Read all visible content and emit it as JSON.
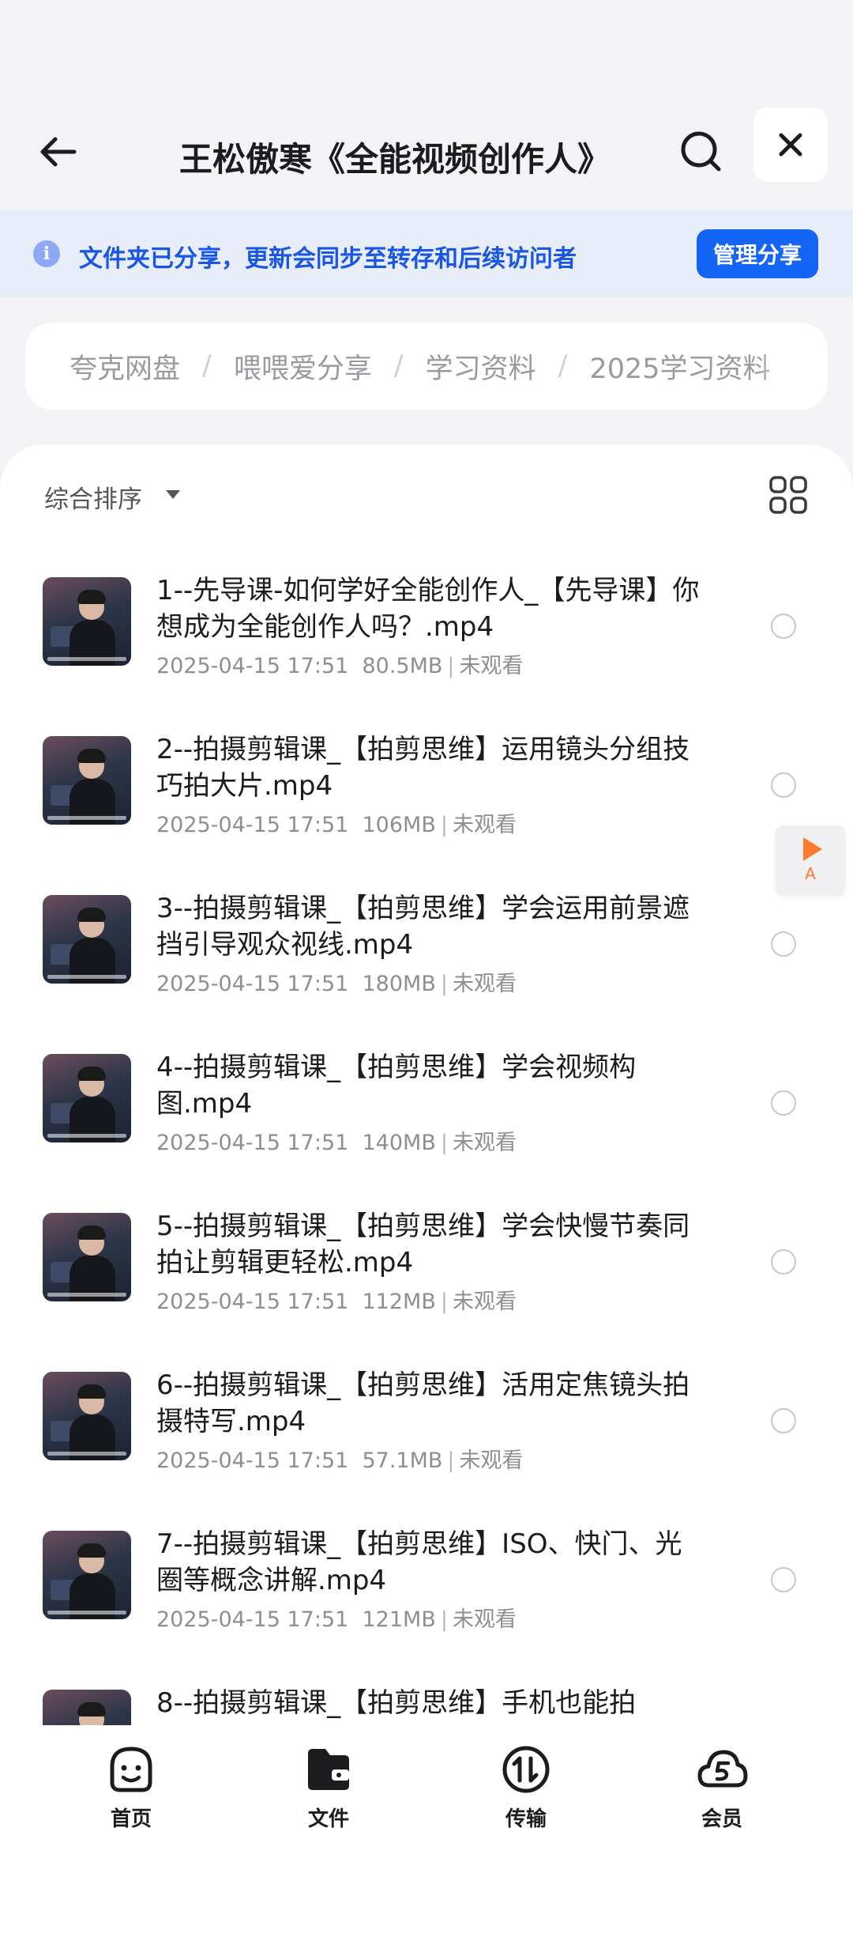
{
  "header": {
    "title": "王松傲寒《全能视频创作人》",
    "back_icon": "arrow-left-icon",
    "search_icon": "search-icon",
    "close_icon": "close-icon"
  },
  "share_banner": {
    "text": "文件夹已分享，更新会同步至转存和后续访问者",
    "button": "管理分享",
    "icon": "info-icon"
  },
  "breadcrumb": [
    "夸克网盘",
    "喂喂爱分享",
    "学习资料",
    "2025学习资料"
  ],
  "sort": {
    "label": "综合排序",
    "view_icon": "grid-view-icon"
  },
  "files": [
    {
      "name": "1--先导课-如何学好全能创作人_【先导课】你想成为全能创作人吗？.mp4",
      "date": "2025-04-15 17:51",
      "size": "80.5MB",
      "status": "未观看"
    },
    {
      "name": "2--拍摄剪辑课_【拍剪思维】运用镜头分组技巧拍大片.mp4",
      "date": "2025-04-15 17:51",
      "size": "106MB",
      "status": "未观看"
    },
    {
      "name": "3--拍摄剪辑课_【拍剪思维】学会运用前景遮挡引导观众视线.mp4",
      "date": "2025-04-15 17:51",
      "size": "180MB",
      "status": "未观看"
    },
    {
      "name": "4--拍摄剪辑课_【拍剪思维】学会视频构图.mp4",
      "date": "2025-04-15 17:51",
      "size": "140MB",
      "status": "未观看"
    },
    {
      "name": "5--拍摄剪辑课_【拍剪思维】学会快慢节奏同拍让剪辑更轻松.mp4",
      "date": "2025-04-15 17:51",
      "size": "112MB",
      "status": "未观看"
    },
    {
      "name": "6--拍摄剪辑课_【拍剪思维】活用定焦镜头拍摄特写.mp4",
      "date": "2025-04-15 17:51",
      "size": "57.1MB",
      "status": "未观看"
    },
    {
      "name": "7--拍摄剪辑课_【拍剪思维】ISO、快门、光圈等概念讲解.mp4",
      "date": "2025-04-15 17:51",
      "size": "121MB",
      "status": "未观看"
    },
    {
      "name": "8--拍摄剪辑课_【拍剪思维】手机也能拍",
      "date": "",
      "size": "",
      "status": ""
    }
  ],
  "float_player": {
    "label": "A",
    "icon": "play-icon"
  },
  "tabs": [
    {
      "label": "首页",
      "icon": "home-face-icon"
    },
    {
      "label": "文件",
      "icon": "folder-icon"
    },
    {
      "label": "传输",
      "icon": "transfer-icon"
    },
    {
      "label": "会员",
      "icon": "member-cloud-icon"
    }
  ],
  "colors": {
    "accent": "#1464f5",
    "banner_bg": "#e8eef9",
    "banner_text": "#1a56e6",
    "float_accent": "#ff7a2e"
  }
}
